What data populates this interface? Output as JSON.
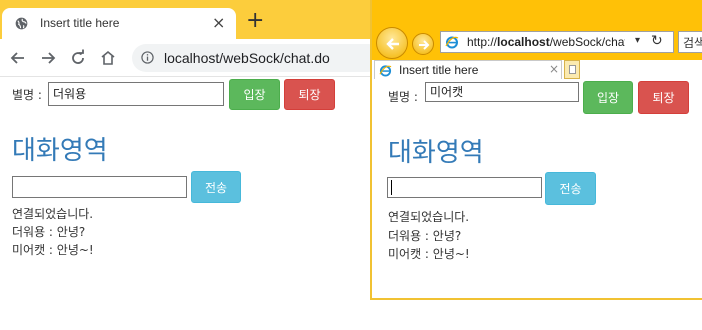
{
  "chrome": {
    "tab_title": "Insert title here",
    "tab_close": "×",
    "new_tab": "+",
    "url_host": "localhost",
    "url_path": "/webSock/chat.do"
  },
  "ie": {
    "address_prefix": "http://",
    "address_host": "localhost",
    "address_path": "/webSock/chat.c",
    "dropdown_arrow": "▾",
    "refresh": "↻",
    "search_label": "검색",
    "tab_title": "Insert title here",
    "tab_close": "×"
  },
  "left_page": {
    "nickname_label": "별명 :",
    "nickname_value": "더워용",
    "enter_button": "입장",
    "exit_button": "퇴장",
    "heading": "대화영역",
    "message_value": "",
    "send_button": "전송",
    "messages": [
      "연결되었습니다.",
      "더워용 : 안녕?",
      "미어캣 : 안녕~!"
    ]
  },
  "right_page": {
    "nickname_label": "별명 :",
    "nickname_value": "미어캣",
    "enter_button": "입장",
    "exit_button": "퇴장",
    "heading": "대화영역",
    "message_value": "",
    "send_button": "전송",
    "messages": [
      "연결되었습니다.",
      "더워용 : 안녕?",
      "미어캣 : 안녕~!"
    ]
  },
  "colors": {
    "chrome_frame": "#fccd3c",
    "ie_frame": "#ffc107",
    "heading": "#337ab7",
    "enter_green": "#5cb85c",
    "exit_red": "#d9534f",
    "send_blue": "#5bc0de"
  },
  "icons": {
    "chrome_favicon": "globe-icon",
    "back": "back-arrow-icon",
    "forward": "forward-arrow-icon",
    "reload": "reload-icon",
    "home": "home-icon",
    "site_info": "info-icon",
    "ie_back": "back-arrow-icon",
    "ie_forward": "forward-arrow-icon",
    "ie_logo": "internet-explorer-icon",
    "ie_new_tab": "new-tab-icon"
  }
}
